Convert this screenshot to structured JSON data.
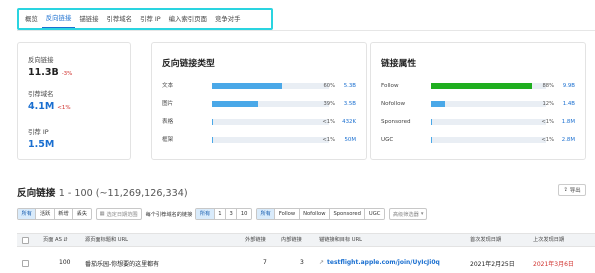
{
  "tabs": [
    "概览",
    "反向链接",
    "锚链接",
    "引荐域名",
    "引荐 IP",
    "编入索引页面",
    "竞争对手"
  ],
  "active_tab": "反向链接",
  "metrics": {
    "backlinks": {
      "label": "反向链接",
      "value": "11.3B",
      "change": "-3%"
    },
    "ref_domains": {
      "label": "引荐域名",
      "value": "4.1M",
      "change": "<1%"
    },
    "ref_ips": {
      "label": "引荐 IP",
      "value": "1.5M"
    }
  },
  "link_types": {
    "title": "反向链接类型",
    "rows": [
      {
        "label": "文本",
        "fraction": 0.6,
        "pct": "60%",
        "value": "5.3B"
      },
      {
        "label": "图片",
        "fraction": 0.39,
        "pct": "39%",
        "value": "3.5B"
      },
      {
        "label": "表格",
        "fraction": 0.005,
        "pct": "<1%",
        "value": "432K"
      },
      {
        "label": "框架",
        "fraction": 0.005,
        "pct": "<1%",
        "value": "50M"
      }
    ]
  },
  "link_attrs": {
    "title": "链接属性",
    "rows": [
      {
        "label": "Follow",
        "fraction": 0.88,
        "pct": "88%",
        "value": "9.9B",
        "color": "#1fae1f"
      },
      {
        "label": "Nofollow",
        "fraction": 0.12,
        "pct": "12%",
        "value": "1.4B",
        "color": "#4aa8e8"
      },
      {
        "label": "Sponsored",
        "fraction": 0.005,
        "pct": "<1%",
        "value": "1.8M",
        "color": "#4aa8e8"
      },
      {
        "label": "UGC",
        "fraction": 0.005,
        "pct": "<1%",
        "value": "2.8M",
        "color": "#4aa8e8"
      }
    ]
  },
  "list": {
    "title": "反向链接",
    "range": "1 - 100 (~11,269,126,334)",
    "export_label": "导出"
  },
  "filters": {
    "status": [
      "所有",
      "活跃",
      "新增",
      "丢失"
    ],
    "date_placeholder": "选定日期范围",
    "per_domain_label": "每个引荐域名的链接",
    "per_domain": [
      "所有",
      "1",
      "3",
      "10"
    ],
    "attrs": [
      "所有",
      "Follow",
      "Nofollow",
      "Sponsored",
      "UGC"
    ],
    "advanced": "高级筛选器"
  },
  "table": {
    "headers": [
      "页面 AS",
      "源页面标题和 URL",
      "外部链接",
      "内部链接",
      "锚链接和目标 URL",
      "首次发现日期",
      "上次发现日期"
    ],
    "rows": [
      {
        "as": "100",
        "title": "番茄乐园-你想要的这里都有",
        "external": "7",
        "internal": "3",
        "target": "testflight.apple.com/join/UyIcJi0q",
        "first_seen": "2021年2月25日",
        "last_seen": "2021年3月6日"
      }
    ]
  }
}
